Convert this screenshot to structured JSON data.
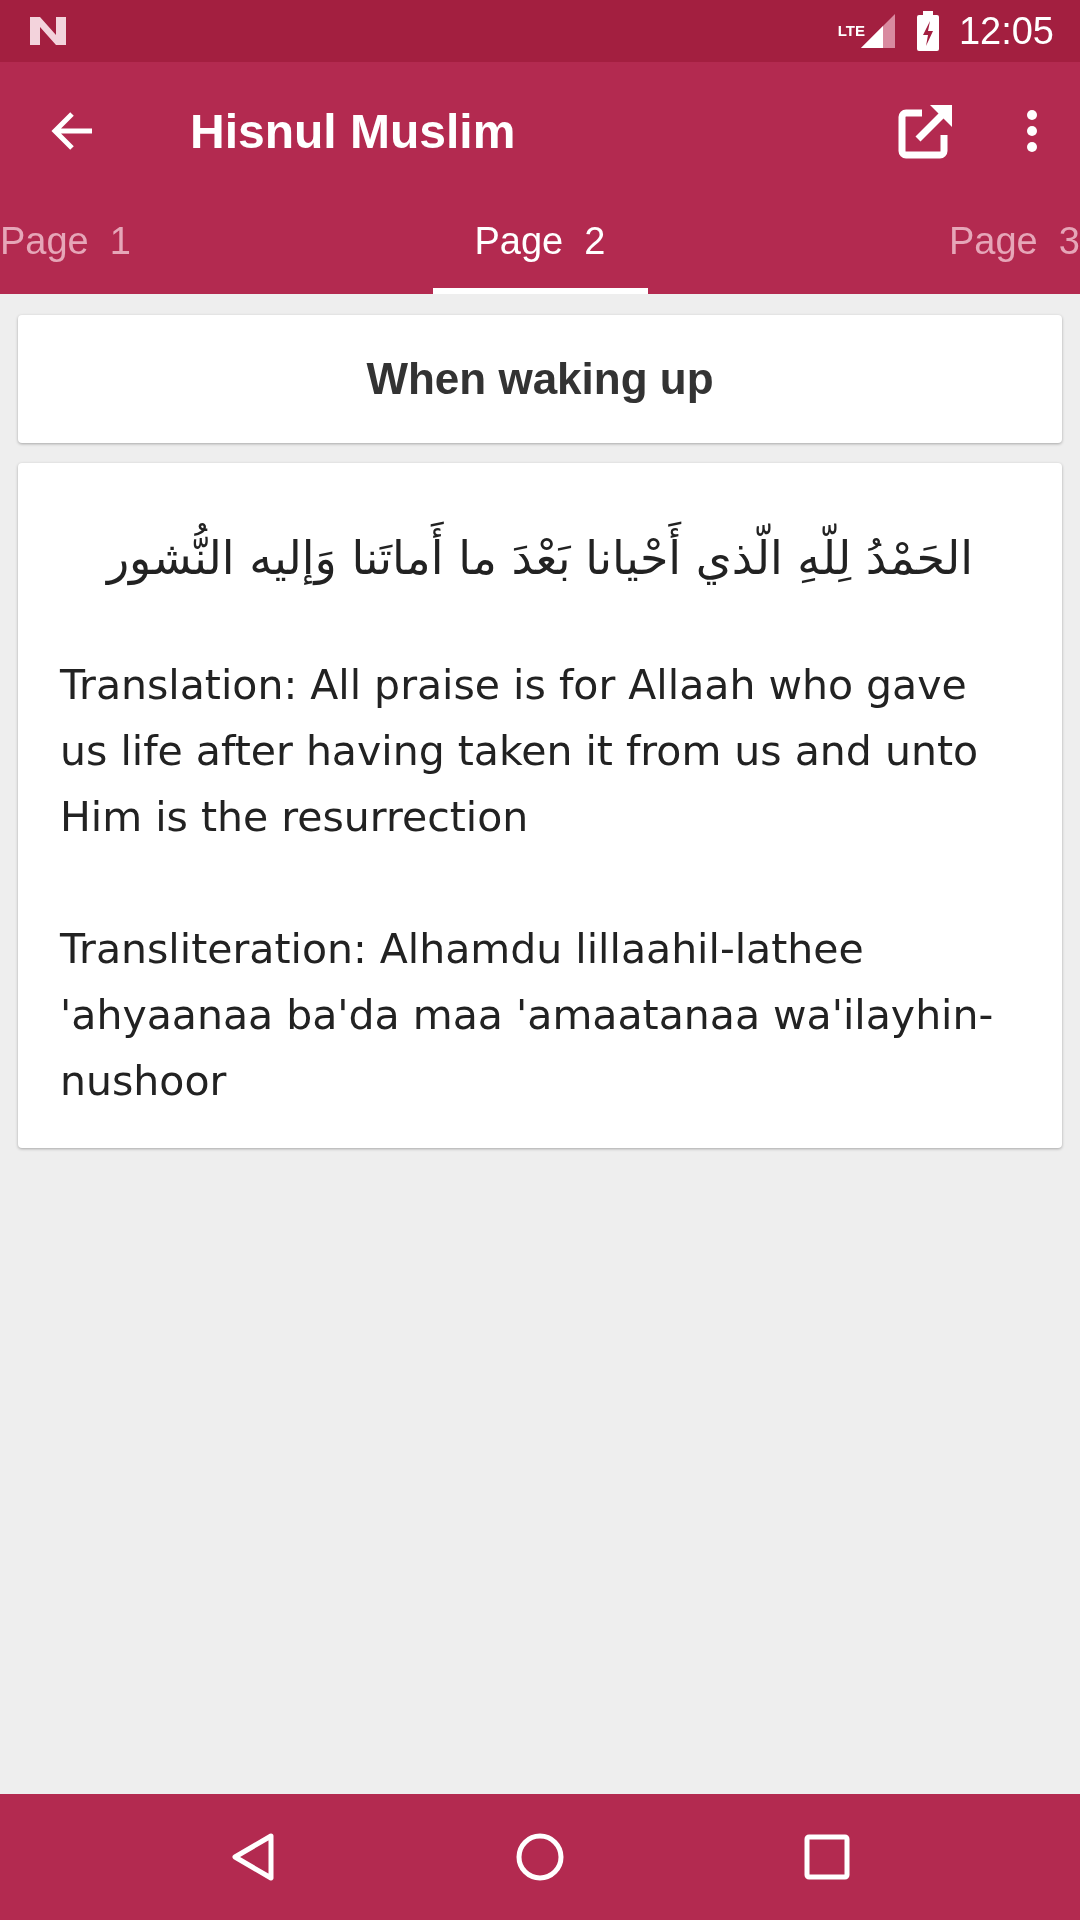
{
  "status_bar": {
    "network": "LTE",
    "time": "12:05"
  },
  "toolbar": {
    "title": "Hisnul Muslim"
  },
  "tabs": [
    {
      "label": "Page  1",
      "selected": false
    },
    {
      "label": "Page  2",
      "selected": true
    },
    {
      "label": "Page  3",
      "selected": false
    }
  ],
  "heading": "When waking up",
  "arabic": "الحَمْدُ لِلّهِ الّذي أَحْيانا بَعْدَ ما أَماتَنا وَإليه النُّشور",
  "paragraphs": [
    "Translation: All praise is for Allaah who gave us life after having taken it from us and unto Him is the resurrection",
    "Transliteration: Alhamdu lillaahil-lathee 'ahyaanaa ba'da maa 'amaatanaa wa'ilayhin-nushoor"
  ]
}
